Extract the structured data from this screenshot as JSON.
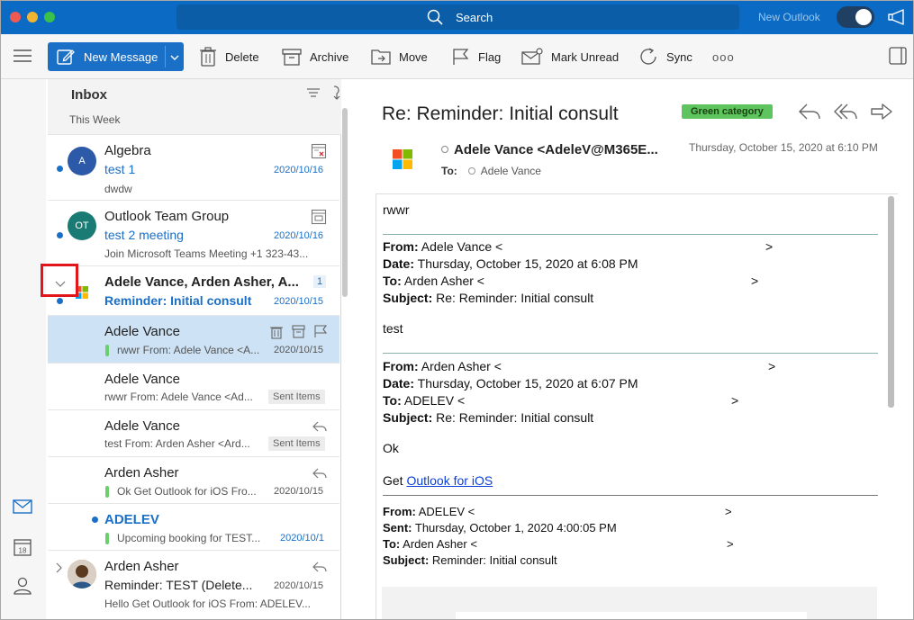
{
  "titlebar": {
    "search_label": "Search",
    "new_outlook_label": "New Outlook",
    "accent": "#0a6ac4"
  },
  "toolbar": {
    "new_message": "New Message",
    "delete": "Delete",
    "archive": "Archive",
    "move": "Move",
    "flag": "Flag",
    "mark_unread": "Mark Unread",
    "sync": "Sync",
    "more": "ooo"
  },
  "rail": {
    "calendar_day": "18"
  },
  "list": {
    "title": "Inbox",
    "group": "This Week",
    "rows": [
      {
        "sender": "Algebra",
        "avatar": "A",
        "avatar_color": "#2d5aa8",
        "subject": "test 1",
        "preview": "dwdw",
        "date": "2020/10/16"
      },
      {
        "sender": "Outlook Team Group",
        "avatar": "OT",
        "avatar_color": "#1a7b74",
        "subject": "test 2 meeting",
        "preview": "Join Microsoft Teams Meeting +1 323-43...",
        "date": "2020/10/16"
      },
      {
        "sender": "Adele Vance, Arden Asher, A...",
        "count": "1",
        "subject": "Reminder: Initial consult",
        "date": "2020/10/15"
      },
      {
        "sender": "Adele Vance",
        "preview": "rwwr From: Adele Vance <A...",
        "date": "2020/10/15"
      },
      {
        "sender": "Adele Vance",
        "preview": "rwwr From: Adele Vance <Ad...",
        "folder": "Sent Items"
      },
      {
        "sender": "Adele Vance",
        "preview": "test From: Arden Asher <Ard...",
        "folder": "Sent Items"
      },
      {
        "sender": "Arden Asher",
        "preview": "Ok Get Outlook for iOS Fro...",
        "date": "2020/10/15"
      },
      {
        "sender": "ADELEV",
        "preview": "Upcoming booking for TEST...",
        "date": "2020/10/1"
      },
      {
        "sender": "Arden Asher",
        "subject": "Reminder: TEST (Delete...",
        "preview": "Hello Get Outlook for iOS From: ADELEV...",
        "date": "2020/10/15"
      }
    ]
  },
  "reading": {
    "subject": "Re: Reminder: Initial consult",
    "category": "Green category",
    "from": "Adele Vance <AdeleV@M365E...",
    "to_label": "To:",
    "to": "Adele Vance",
    "date": "Thursday, October 15, 2020 at 6:10 PM",
    "body": {
      "line1": "rwwr",
      "q1_from_label": "From:",
      "q1_from": "Adele Vance <",
      "q1_date_label": "Date:",
      "q1_date": "Thursday, October 15, 2020 at 6:08 PM",
      "q1_to_label": "To:",
      "q1_to": "Arden Asher <",
      "q1_subject_label": "Subject:",
      "q1_subject": "Re: Reminder: Initial consult",
      "line2": "test",
      "q2_from_label": "From:",
      "q2_from": "Arden Asher <",
      "q2_date_label": "Date:",
      "q2_date": "Thursday, October 15, 2020 at 6:07 PM",
      "q2_to_label": "To:",
      "q2_to": "ADELEV <",
      "q2_subject_label": "Subject:",
      "q2_subject": "Re: Reminder: Initial consult",
      "line3": "Ok",
      "get_prefix": "Get",
      "get_link": "Outlook for iOS",
      "q3_from_label": "From:",
      "q3_from": "ADELEV <",
      "q3_sent_label": "Sent:",
      "q3_sent": "Thursday, October 1, 2020 4:00:05 PM",
      "q3_to_label": "To:",
      "q3_to": "Arden Asher <",
      "q3_subject_label": "Subject:",
      "q3_subject": "Reminder: Initial consult",
      "gt": ">"
    }
  }
}
